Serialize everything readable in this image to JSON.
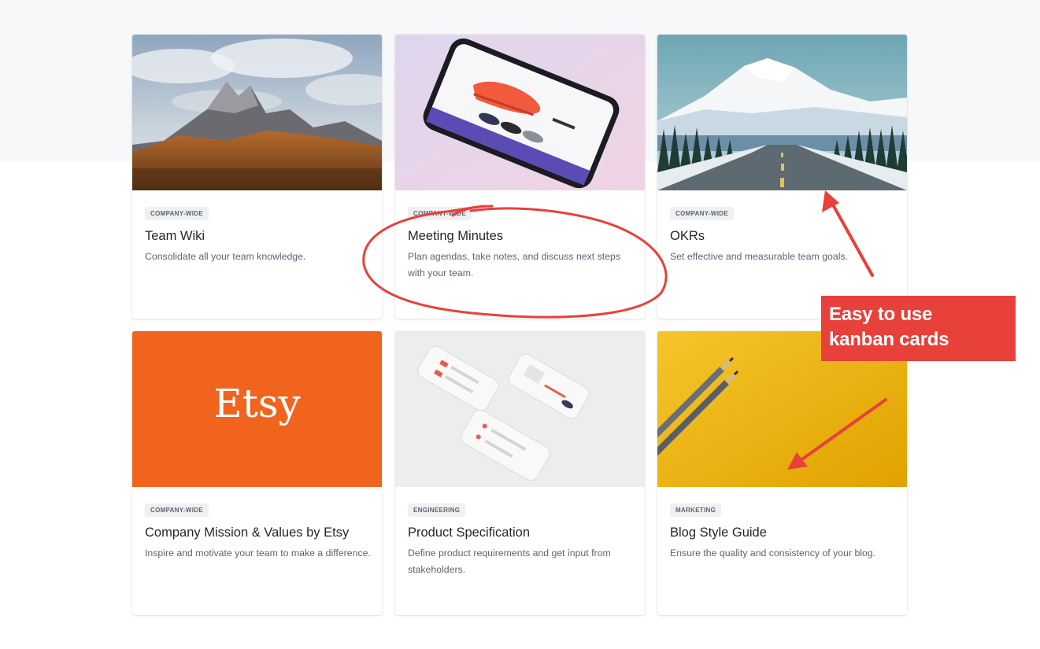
{
  "cards": [
    {
      "tag": "COMPANY-WIDE",
      "title": "Team Wiki",
      "description": "Consolidate all your team knowledge.",
      "image": "mountain-forest"
    },
    {
      "tag": "COMPANY-WIDE",
      "title": "Meeting Minutes",
      "description": "Plan agendas, take notes, and discuss next steps with your team.",
      "image": "phone-shoe-app"
    },
    {
      "tag": "COMPANY-WIDE",
      "title": "OKRs",
      "description": "Set effective and measurable team goals.",
      "image": "snowy-mountain-road"
    },
    {
      "tag": "COMPANY-WIDE",
      "title": "Company Mission & Values by Etsy",
      "description": "Inspire and motivate your team to make a difference.",
      "image": "etsy-logo",
      "image_text": "Etsy"
    },
    {
      "tag": "ENGINEERING",
      "title": "Product Specification",
      "description": "Define product requirements and get input from stakeholders.",
      "image": "phone-mockups"
    },
    {
      "tag": "MARKETING",
      "title": "Blog Style Guide",
      "description": "Ensure the quality and consistency of your blog.",
      "image": "pencils-yellow"
    }
  ],
  "annotation": {
    "callout_line1": "Easy to use",
    "callout_line2": "kanban cards",
    "accent_color": "#e8403b"
  },
  "colors": {
    "etsy_orange": "#f1641e",
    "marketing_yellow": "#f4b400"
  }
}
